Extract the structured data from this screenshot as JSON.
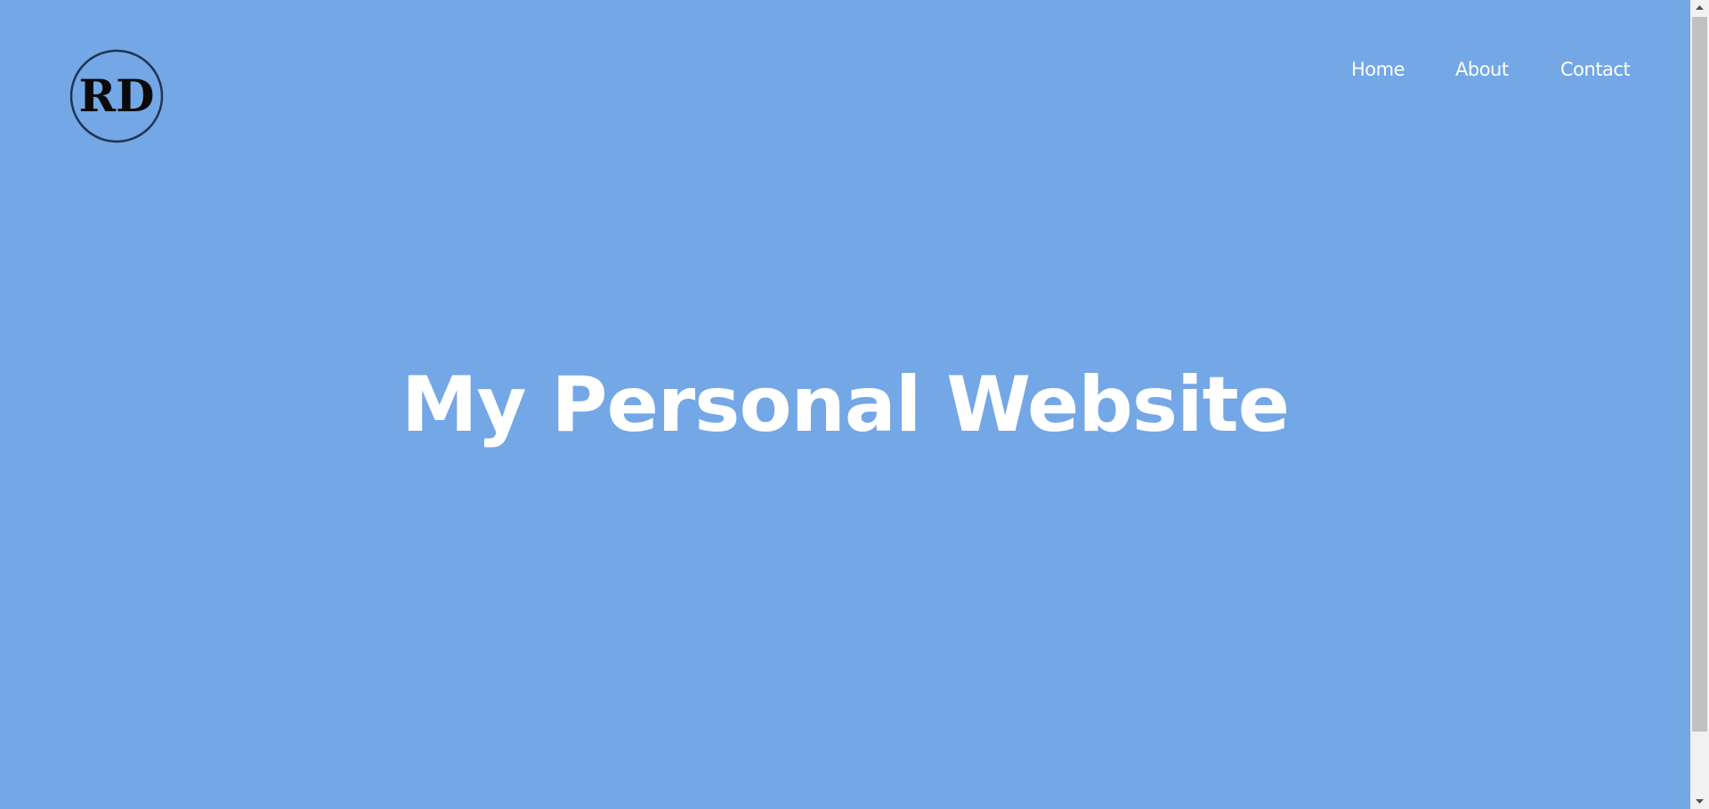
{
  "logo": {
    "icon": "rd-monogram-logo",
    "letters": "RD"
  },
  "nav": {
    "items": [
      {
        "label": "Home"
      },
      {
        "label": "About"
      },
      {
        "label": "Contact"
      }
    ]
  },
  "hero": {
    "title": "My Personal Website"
  },
  "colors": {
    "background": "#73a7e6",
    "text": "#ffffff",
    "logo_ring": "#1e3553",
    "scrollbar_track": "#f1f1f1",
    "scrollbar_thumb": "#c1c1c1"
  }
}
